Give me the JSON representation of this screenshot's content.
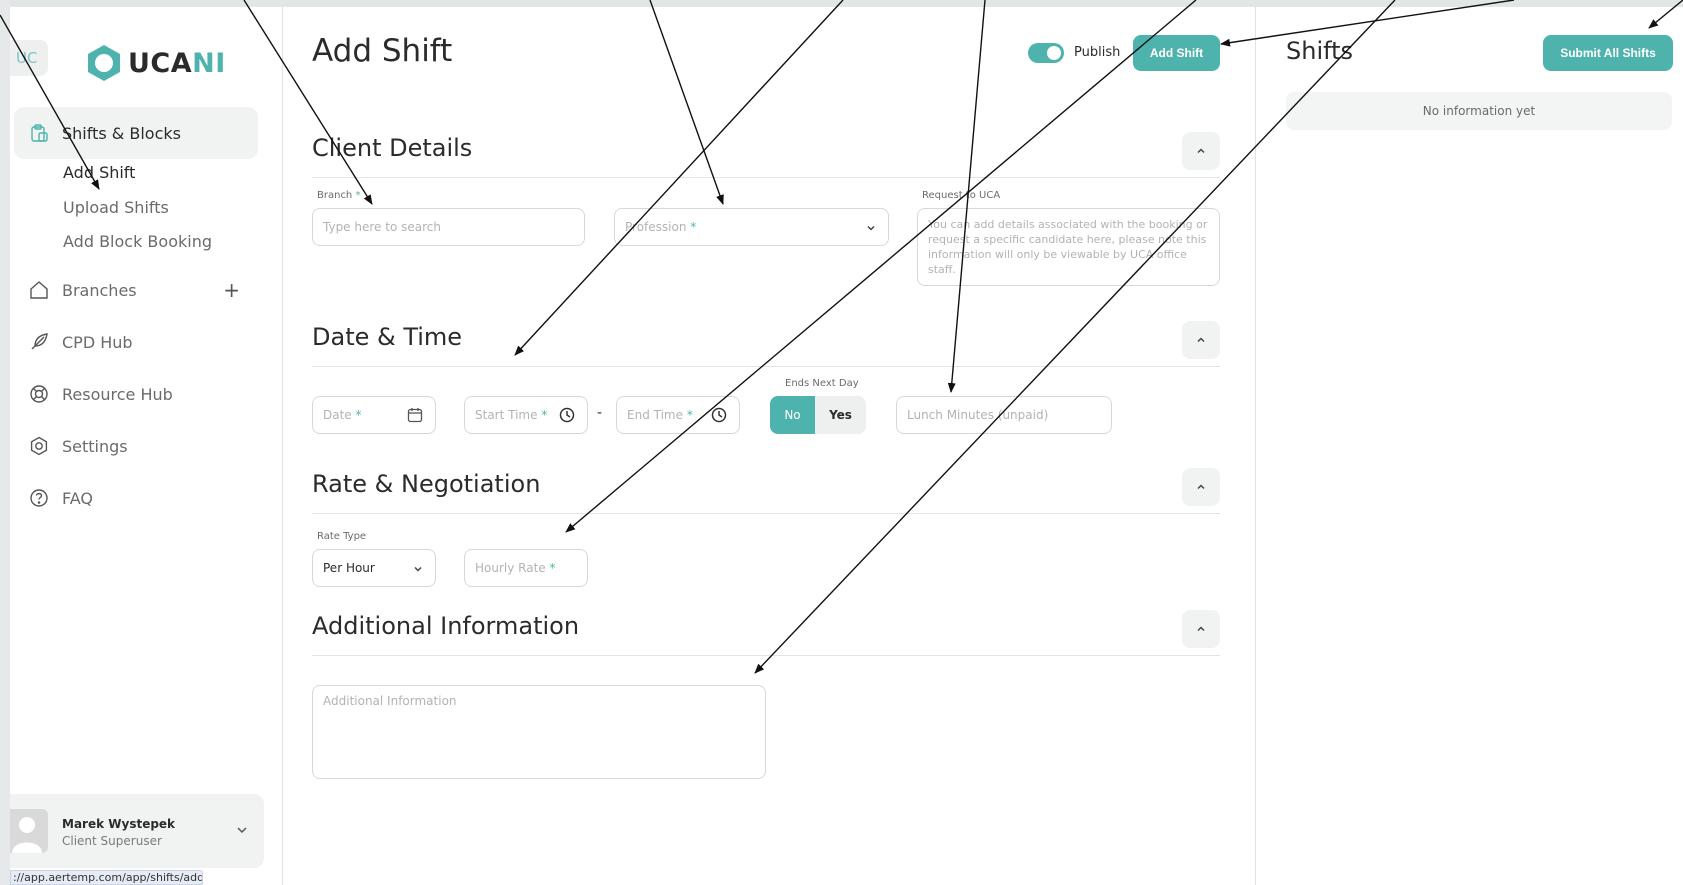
{
  "sidebar": {
    "uc_tag": "UC",
    "logo_main": "UCA",
    "logo_accent": "NI",
    "shifts_blocks": "Shifts & Blocks",
    "sub_items": [
      "Add Shift",
      "Upload Shifts",
      "Add Block Booking"
    ],
    "nav": [
      "Branches",
      "CPD Hub",
      "Resource Hub",
      "Settings",
      "FAQ"
    ],
    "branches_plus": "+",
    "user_name": "Marek Wystepek",
    "user_role": "Client Superuser"
  },
  "status_url": "://app.aertemp.com/app/shifts/add",
  "header": {
    "title": "Add Shift",
    "publish_label": "Publish",
    "publish_on": true,
    "add_shift_button": "Add Shift"
  },
  "client_details": {
    "title": "Client Details",
    "branch_label": "Branch",
    "branch_required": "*",
    "branch_placeholder": "Type here to search",
    "profession_placeholder": "Profession",
    "profession_required": "*",
    "request_label": "Request to UCA",
    "request_placeholder": "You can add details associated with the booking or request a specific candidate here, please note this information will only be viewable by UCA office staff."
  },
  "date_time": {
    "title": "Date & Time",
    "date_placeholder": "Date",
    "start_placeholder": "Start Time",
    "end_placeholder": "End Time",
    "required": "*",
    "dash": "-",
    "ends_next_day_label": "Ends Next Day",
    "no_label": "No",
    "yes_label": "Yes",
    "selected": "No",
    "lunch_placeholder": "Lunch Minutes (unpaid)"
  },
  "rate": {
    "title": "Rate & Negotiation",
    "rate_type_label": "Rate Type",
    "rate_type_value": "Per Hour",
    "hourly_placeholder": "Hourly Rate",
    "required": "*"
  },
  "additional": {
    "title": "Additional Information",
    "placeholder": "Additional Information"
  },
  "shifts_panel": {
    "title": "Shifts",
    "submit_button": "Submit All Shifts",
    "empty_text": "No information yet"
  },
  "colors": {
    "accent": "#4fb3ad",
    "panel_bg": "#f1f3f3",
    "border": "#d8d8d8"
  }
}
